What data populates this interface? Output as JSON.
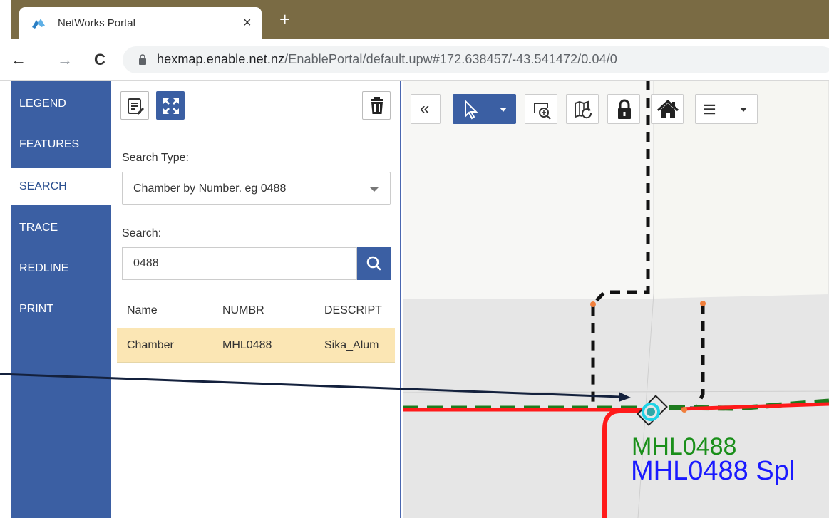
{
  "browser": {
    "tab_title": "NetWorks Portal",
    "close_glyph": "×",
    "newtab_glyph": "+",
    "back_glyph": "←",
    "forward_glyph": "→",
    "reload_glyph": "C",
    "url_host": "hexmap.enable.net.nz",
    "url_path": "/EnablePortal/default.upw#172.638457/-43.541472/0.04/0"
  },
  "sidebar": {
    "items": [
      {
        "label": "LEGEND"
      },
      {
        "label": "FEATURES"
      },
      {
        "label": "SEARCH",
        "active": true
      },
      {
        "label": "TRACE"
      },
      {
        "label": "REDLINE"
      },
      {
        "label": "PRINT"
      }
    ]
  },
  "panel": {
    "toolbar_icons": [
      "edit-list-icon",
      "expand-icon",
      "trash-icon"
    ],
    "search_type_label": "Search Type:",
    "search_type_value": "Chamber by Number. eg 0488",
    "search_label": "Search:",
    "search_value": "0488",
    "search_button_icon": "search-icon",
    "results": {
      "columns": [
        "Name",
        "NUMBR",
        "DESCRIPT"
      ],
      "rows": [
        {
          "name": "Chamber",
          "numbr": "MHL0488",
          "descript": "Sika_Alum"
        }
      ]
    }
  },
  "map": {
    "toolbar_icons": [
      "double-chevron-left-icon",
      "pointer-icon",
      "dropdown-icon",
      "zoom-box-icon",
      "map-refresh-icon",
      "lock-icon",
      "home-icon",
      "menu-icon"
    ],
    "collapse_glyph": "«",
    "menu_glyph": "≡",
    "label_number": "MHL0488",
    "label_description": "MHL0488 Spl",
    "colors": {
      "cable_red": "#ff1a1a",
      "duct_green": "#1e7b1e",
      "highlight_cyan": "#1fd3e6",
      "label_green": "#1a8f1a",
      "label_blue": "#1a1aff",
      "node_orange": "#f07f3c"
    }
  },
  "colors": {
    "nav_blue": "#3b5fa3",
    "chrome_olive": "#7a6b44",
    "selected_row": "#fbe6b4"
  }
}
